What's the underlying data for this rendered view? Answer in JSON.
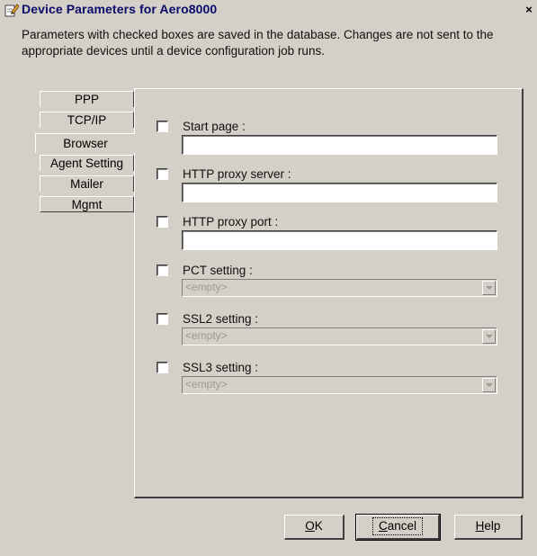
{
  "window": {
    "title": "Device Parameters for Aero8000",
    "close_symbol": "×"
  },
  "description": "Parameters with checked boxes are saved in the database. Changes are not sent to the appropriate devices until a device configuration job runs.",
  "tabs": [
    {
      "label": "PPP"
    },
    {
      "label": "TCP/IP"
    },
    {
      "label": "Browser",
      "selected": true
    },
    {
      "label": "Agent Setting"
    },
    {
      "label": "Mailer"
    },
    {
      "label": "Mgmt"
    }
  ],
  "fields": [
    {
      "label": "Start page :",
      "type": "text",
      "value": ""
    },
    {
      "label": "HTTP proxy server :",
      "type": "text",
      "value": ""
    },
    {
      "label": "HTTP proxy port :",
      "type": "text",
      "value": ""
    },
    {
      "label": "PCT setting :",
      "type": "combo",
      "value": "<empty>"
    },
    {
      "label": "SSL2 setting :",
      "type": "combo",
      "value": "<empty>"
    },
    {
      "label": "SSL3 setting :",
      "type": "combo",
      "value": "<empty>"
    }
  ],
  "buttons": {
    "ok": {
      "mnemonic": "O",
      "rest": "K"
    },
    "cancel": {
      "mnemonic": "C",
      "rest": "ancel"
    },
    "help": {
      "mnemonic": "H",
      "rest": "elp"
    }
  },
  "colors": {
    "face": "#d4d0c8",
    "title_text": "#0a0a6a",
    "disabled_text": "#9c9a94"
  },
  "icons": {
    "title": "edit-pen-icon",
    "close": "close-icon",
    "combo": "chevron-down-icon"
  }
}
